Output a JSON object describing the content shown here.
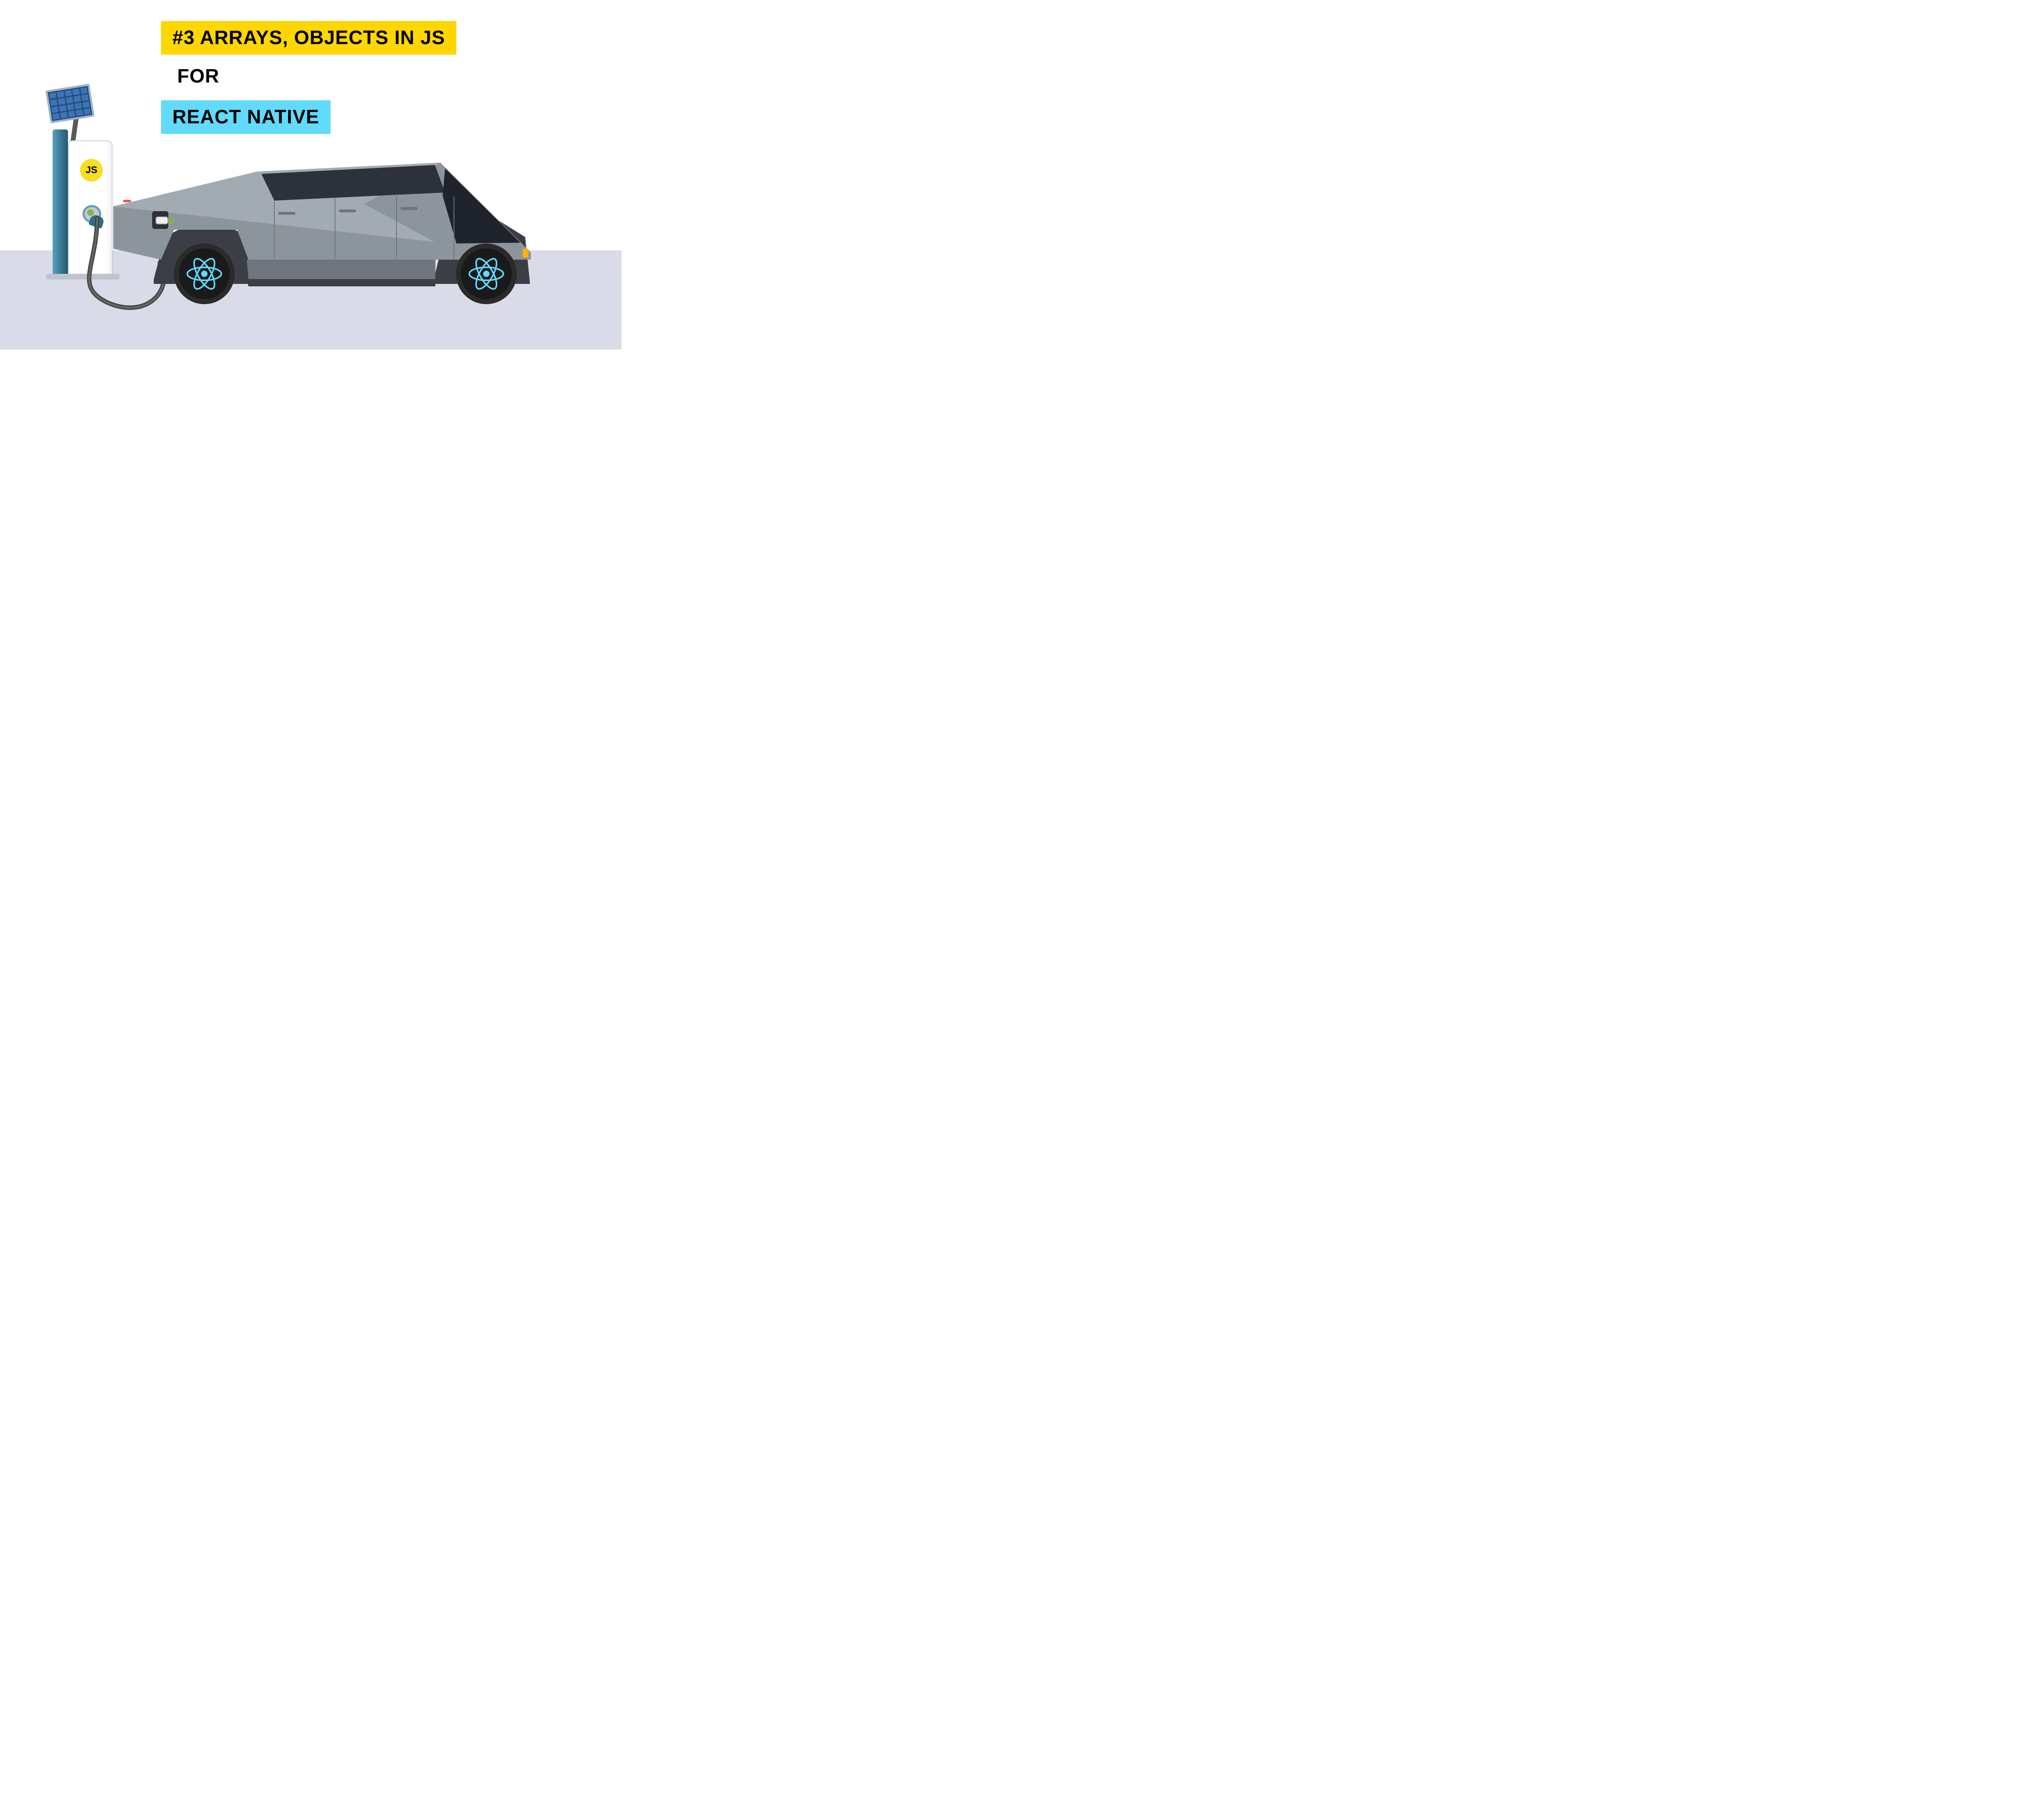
{
  "title": {
    "line1": "#3 ARRAYS, OBJECTS IN JS",
    "line2": "FOR",
    "line3": "REACT NATIVE"
  },
  "charger": {
    "badge_text": "JS"
  },
  "colors": {
    "accent_yellow": "#ffd600",
    "react_cyan": "#61dafb",
    "js_yellow": "#f7df1e"
  }
}
